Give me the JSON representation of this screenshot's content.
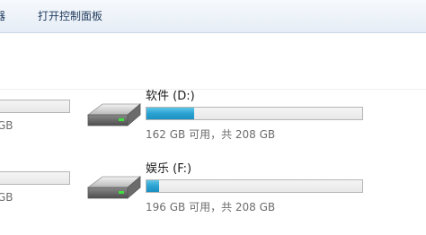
{
  "toolbar": {
    "partial_label": "器",
    "open_control_panel": "打开控制面板"
  },
  "left_column": {
    "drive1_text": "GB",
    "drive2_text": "GB"
  },
  "drives": [
    {
      "name": "软件 (D:)",
      "free_text": "162 GB 可用，共 208 GB",
      "used_fraction": 0.22
    },
    {
      "name": "娱乐 (F:)",
      "free_text": "196 GB 可用，共 208 GB",
      "used_fraction": 0.06
    }
  ],
  "colors": {
    "bar_fill": "#2aa3d2",
    "toolbar_bg": "#e6edf6"
  }
}
